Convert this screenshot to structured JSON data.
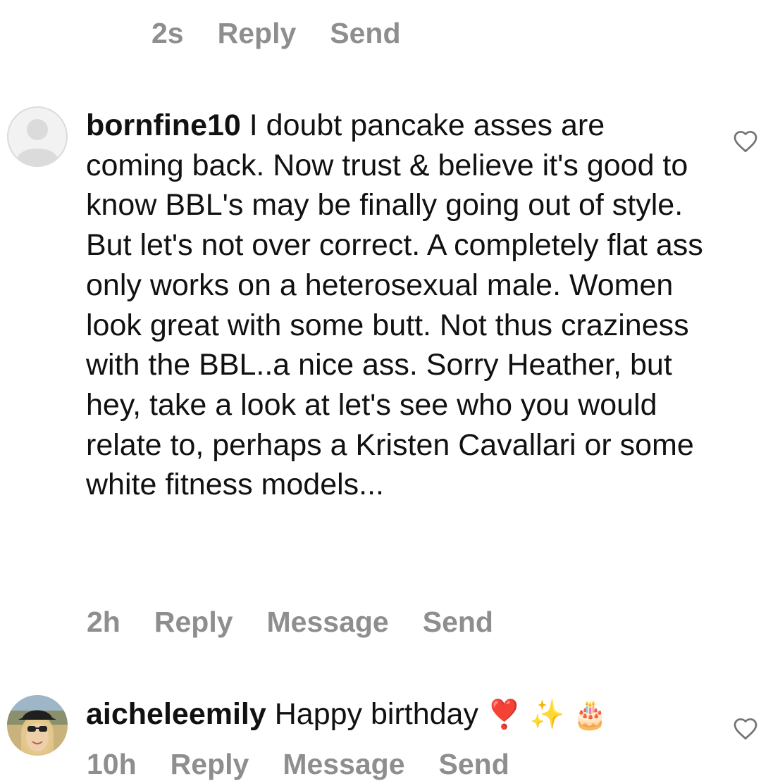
{
  "top_action_row": {
    "time": "2s",
    "reply": "Reply",
    "send": "Send"
  },
  "comments": [
    {
      "username": "bornfine10",
      "text": " I doubt pancake asses are coming back.  Now trust & believe it's good to  know BBL's may be finally going out of style. But let's not over correct. A completely flat ass only works on a heterosexual male. Women look great with some butt. Not thus craziness with the BBL..a nice ass. Sorry Heather, but hey, take a look at let's see who you would relate to, perhaps a Kristen Cavallari or some white fitness models...",
      "time": "2h",
      "reply": "Reply",
      "message": "Message",
      "send": "Send",
      "avatar": "default-avatar-icon",
      "like_icon": "heart-outline-icon"
    },
    {
      "username": "aicheleemily",
      "text": " Happy birthday ",
      "emojis": "❣️ ✨ 🎂",
      "time": "10h",
      "reply": "Reply",
      "message": "Message",
      "send": "Send",
      "avatar": "profile-photo",
      "like_icon": "heart-outline-icon"
    }
  ],
  "colors": {
    "text": "#111111",
    "meta": "#8e8e8e",
    "icon": "#737373"
  }
}
